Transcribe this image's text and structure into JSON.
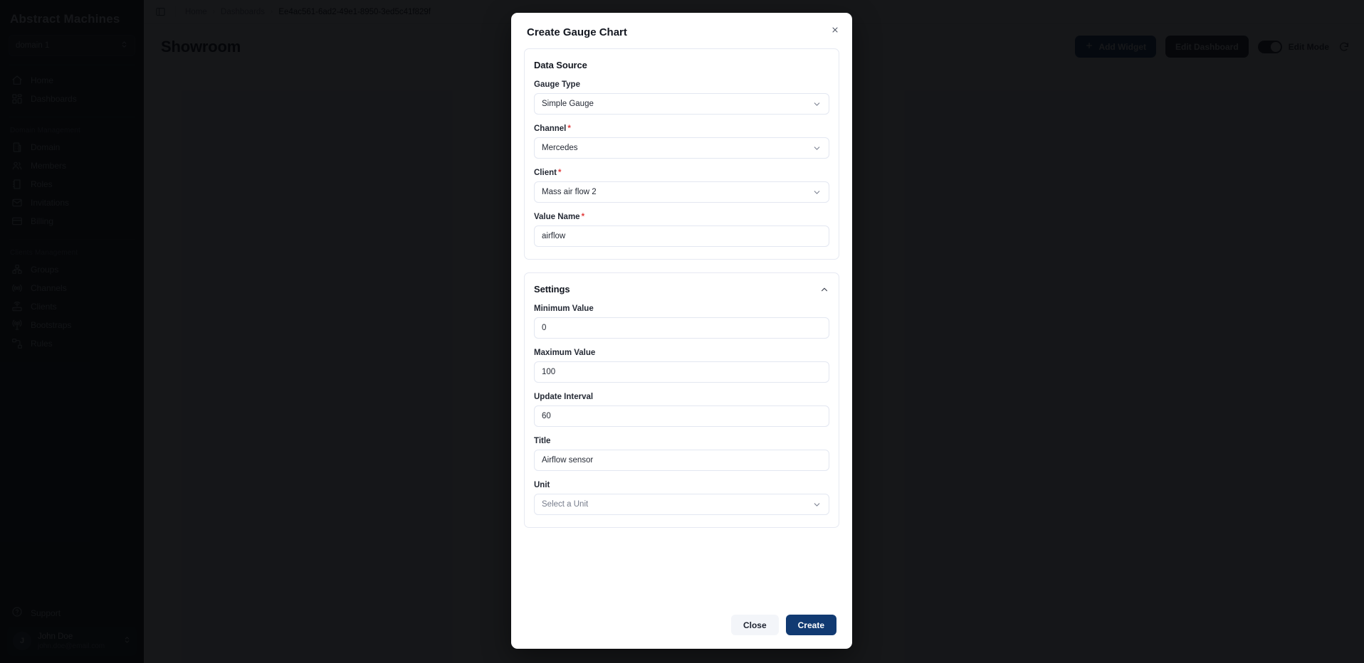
{
  "sidebar": {
    "brand": "Abstract Machines",
    "domain_selector": {
      "value": "domain 1",
      "icon": "chevron-updown-icon"
    },
    "main_items": [
      {
        "label": "Home",
        "icon": "home-icon"
      },
      {
        "label": "Dashboards",
        "icon": "dashboards-icon"
      }
    ],
    "domain_section": {
      "title": "Domain Management",
      "items": [
        {
          "label": "Domain",
          "icon": "building-icon"
        },
        {
          "label": "Members",
          "icon": "users-icon"
        },
        {
          "label": "Roles",
          "icon": "roles-icon"
        },
        {
          "label": "Invitations",
          "icon": "mail-icon"
        },
        {
          "label": "Billing",
          "icon": "credit-card-icon"
        }
      ]
    },
    "clients_section": {
      "title": "Clients Management",
      "items": [
        {
          "label": "Groups",
          "icon": "groups-icon"
        },
        {
          "label": "Channels",
          "icon": "channels-icon"
        },
        {
          "label": "Clients",
          "icon": "router-icon"
        },
        {
          "label": "Bootstraps",
          "icon": "broadcast-icon"
        },
        {
          "label": "Rules",
          "icon": "rules-icon"
        }
      ]
    },
    "support": {
      "label": "Support",
      "icon": "help-circle-icon"
    },
    "user": {
      "initial": "J",
      "name": "John Doe",
      "email": "john.doe@email.com",
      "icon": "chevron-updown-icon"
    }
  },
  "topbar": {
    "panel_icon": "panel-toggle-icon",
    "breadcrumb": [
      {
        "label": "Home"
      },
      {
        "label": "Dashboards"
      },
      {
        "label": "Ee4ac561-6ad2-49e1-8950-3ed5c41f829f"
      }
    ],
    "separator": "›"
  },
  "page": {
    "title": "Showroom",
    "add_widget_label": "Add Widget",
    "add_widget_icon": "plus-icon",
    "edit_dashboard_label": "Edit Dashboard",
    "edit_mode_label": "Edit Mode",
    "edit_mode_on": true,
    "refresh_icon": "refresh-icon"
  },
  "modal": {
    "title": "Create Gauge Chart",
    "close_icon": "close-icon",
    "data_source": {
      "title": "Data Source",
      "fields": [
        {
          "label": "Gauge Type",
          "required": false,
          "type": "select",
          "value": "Simple Gauge",
          "placeholder": false,
          "icon": "chevron-down-icon"
        },
        {
          "label": "Channel",
          "required": true,
          "type": "select",
          "value": "Mercedes",
          "placeholder": false,
          "icon": "chevron-down-icon"
        },
        {
          "label": "Client",
          "required": true,
          "type": "select",
          "value": "Mass air flow 2",
          "placeholder": false,
          "icon": "chevron-down-icon"
        },
        {
          "label": "Value Name",
          "required": true,
          "type": "text",
          "value": "airflow",
          "placeholder": false
        }
      ]
    },
    "settings": {
      "title": "Settings",
      "collapse_icon": "chevron-up-icon",
      "fields": [
        {
          "label": "Minimum Value",
          "required": false,
          "type": "text",
          "value": "0",
          "placeholder": false
        },
        {
          "label": "Maximum Value",
          "required": false,
          "type": "text",
          "value": "100",
          "placeholder": false
        },
        {
          "label": "Update Interval",
          "required": false,
          "type": "text",
          "value": "60",
          "placeholder": false
        },
        {
          "label": "Title",
          "required": false,
          "type": "text",
          "value": "Airflow sensor",
          "placeholder": false
        },
        {
          "label": "Unit",
          "required": false,
          "type": "select",
          "value": "Select a Unit",
          "placeholder": true,
          "icon": "chevron-down-icon"
        }
      ]
    },
    "footer": {
      "close_label": "Close",
      "create_label": "Create"
    }
  },
  "colors": {
    "accent": "#113a72",
    "sidebar_bg": "#11131a",
    "required_asterisk": "#e23c3c",
    "overlay": "rgba(4,5,8,0.93)"
  }
}
